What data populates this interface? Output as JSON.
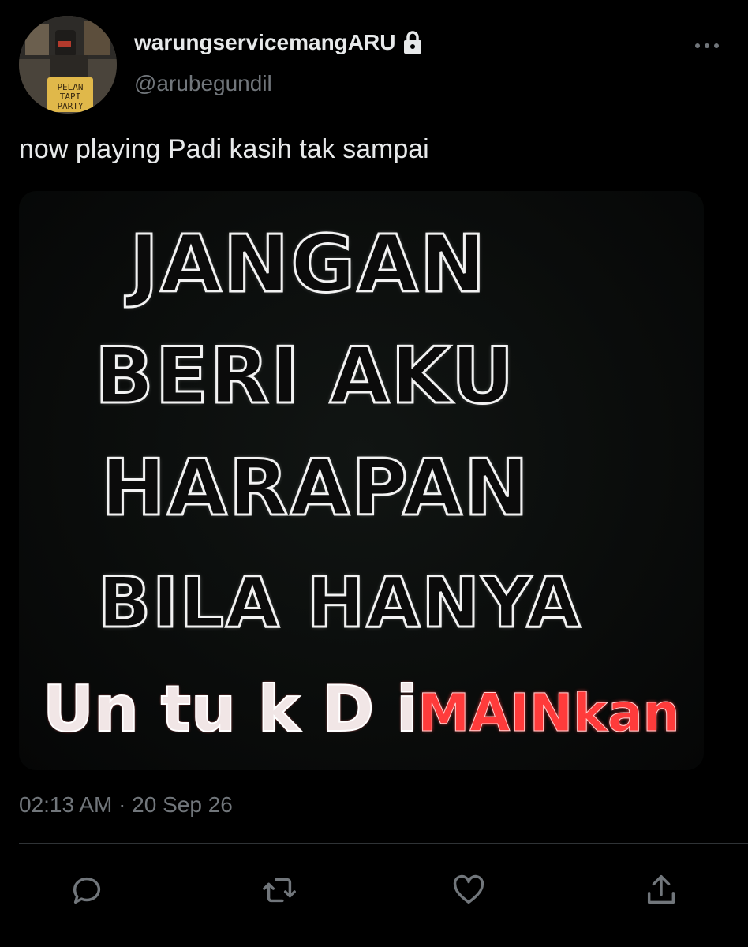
{
  "author": {
    "display_name": "warungservicemangARU",
    "handle": "@arubegundil",
    "avatar_text": [
      "PELAN",
      "TAPI",
      "PARTY"
    ]
  },
  "tweet": {
    "text": "now playing Padi kasih tak sampai",
    "timestamp": "02:13 AM · 20 Sep 26"
  },
  "media": {
    "lines": [
      "JANGAN",
      "BERI AKU",
      "HARAPAN",
      "BILA HANYA"
    ],
    "last_line_a": "Un tu k D i",
    "last_line_b": "MAINkan"
  },
  "actions": [
    "reply-icon",
    "retweet-icon",
    "like-icon",
    "share-icon"
  ],
  "colors": {
    "background": "#000000",
    "text": "#e7e9ea",
    "secondary": "#71767b",
    "divider": "#2f3336"
  }
}
